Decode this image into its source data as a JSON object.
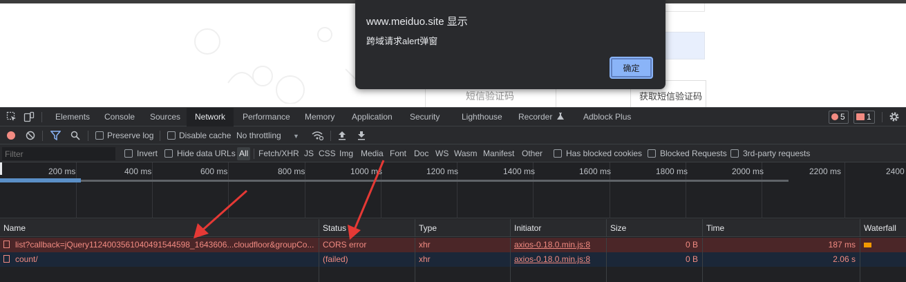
{
  "page": {
    "sms_placeholder": "短信验证码",
    "sms_left_fragment": "短信验证码",
    "get_code_button": "获取短信验证码"
  },
  "alert": {
    "title": "www.meiduo.site 显示",
    "message": "跨域请求alert弹窗",
    "ok_label": "确定"
  },
  "devtools": {
    "tabs": [
      "Elements",
      "Console",
      "Sources",
      "Network",
      "Performance",
      "Memory",
      "Application",
      "Security",
      "Lighthouse",
      "Recorder",
      "Adblock Plus"
    ],
    "active_tab": "Network",
    "error_count": "5",
    "issue_count": "1"
  },
  "network_toolbar": {
    "preserve_log": "Preserve log",
    "disable_cache": "Disable cache",
    "throttling": "No throttling"
  },
  "filter_bar": {
    "placeholder": "Filter",
    "invert": "Invert",
    "hide_data_urls": "Hide data URLs",
    "types": [
      "All",
      "Fetch/XHR",
      "JS",
      "CSS",
      "Img",
      "Media",
      "Font",
      "Doc",
      "WS",
      "Wasm",
      "Manifest",
      "Other"
    ],
    "has_blocked_cookies": "Has blocked cookies",
    "blocked_requests": "Blocked Requests",
    "third_party": "3rd-party requests"
  },
  "overview": {
    "ticks": [
      "200 ms",
      "400 ms",
      "600 ms",
      "800 ms",
      "1000 ms",
      "1200 ms",
      "1400 ms",
      "1600 ms",
      "1800 ms",
      "2000 ms",
      "2200 ms",
      "2400"
    ]
  },
  "table": {
    "columns": [
      "Name",
      "Status",
      "Type",
      "Initiator",
      "Size",
      "Time",
      "Waterfall"
    ],
    "rows": [
      {
        "name": "list?callback=jQuery1124003561040491544598_1643606...cloudfloor&groupCo...",
        "status": "CORS error",
        "type": "xhr",
        "initiator": "axios-0.18.0.min.js:8",
        "size": "0 B",
        "time": "187 ms"
      },
      {
        "name": "count/",
        "status": "(failed)",
        "type": "xhr",
        "initiator": "axios-0.18.0.min.js:8",
        "size": "0 B",
        "time": "2.06 s"
      }
    ]
  },
  "colors": {
    "error_text": "#f28b82",
    "error_row_bg": "#4b2628",
    "annotation_arrow": "#e53935",
    "accent": "#8ab4f8"
  }
}
